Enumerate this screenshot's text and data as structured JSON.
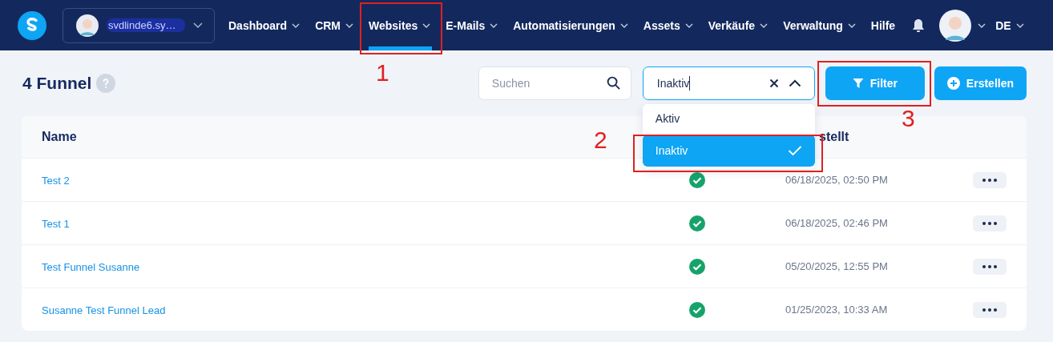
{
  "navbar": {
    "account": {
      "name": "svdlinde6.sy…"
    },
    "menu": [
      {
        "label": "Dashboard",
        "selected": false,
        "has_menu": true
      },
      {
        "label": "CRM",
        "selected": false,
        "has_menu": true
      },
      {
        "label": "Websites",
        "selected": true,
        "has_menu": true
      },
      {
        "label": "E-Mails",
        "selected": false,
        "has_menu": true
      },
      {
        "label": "Automatisierungen",
        "selected": false,
        "has_menu": true
      },
      {
        "label": "Assets",
        "selected": false,
        "has_menu": true
      },
      {
        "label": "Verkäufe",
        "selected": false,
        "has_menu": true
      },
      {
        "label": "Verwaltung",
        "selected": false,
        "has_menu": true
      },
      {
        "label": "Hilfe",
        "selected": false,
        "has_menu": false
      }
    ],
    "language": "DE"
  },
  "page": {
    "title": "4 Funnel"
  },
  "toolbar": {
    "search": {
      "placeholder": "Suchen"
    },
    "status_select": {
      "value": "Inaktiv",
      "expanded": true,
      "options": [
        {
          "label": "Aktiv",
          "selected": false
        },
        {
          "label": "Inaktiv",
          "selected": true
        }
      ]
    },
    "filter_button": "Filter",
    "create_button": "Erstellen"
  },
  "table": {
    "columns": [
      "Name",
      "stellt"
    ],
    "rows": [
      {
        "name": "Test 2",
        "active": true,
        "created": "06/18/2025, 02:50 PM"
      },
      {
        "name": "Test 1",
        "active": true,
        "created": "06/18/2025, 02:46 PM"
      },
      {
        "name": "Test Funnel Susanne",
        "active": true,
        "created": "05/20/2025, 12:55 PM"
      },
      {
        "name": "Susanne Test Funnel Lead",
        "active": true,
        "created": "01/25/2023, 10:33 AM"
      }
    ]
  },
  "annotations": [
    {
      "label": "1"
    },
    {
      "label": "2"
    },
    {
      "label": "3"
    }
  ]
}
